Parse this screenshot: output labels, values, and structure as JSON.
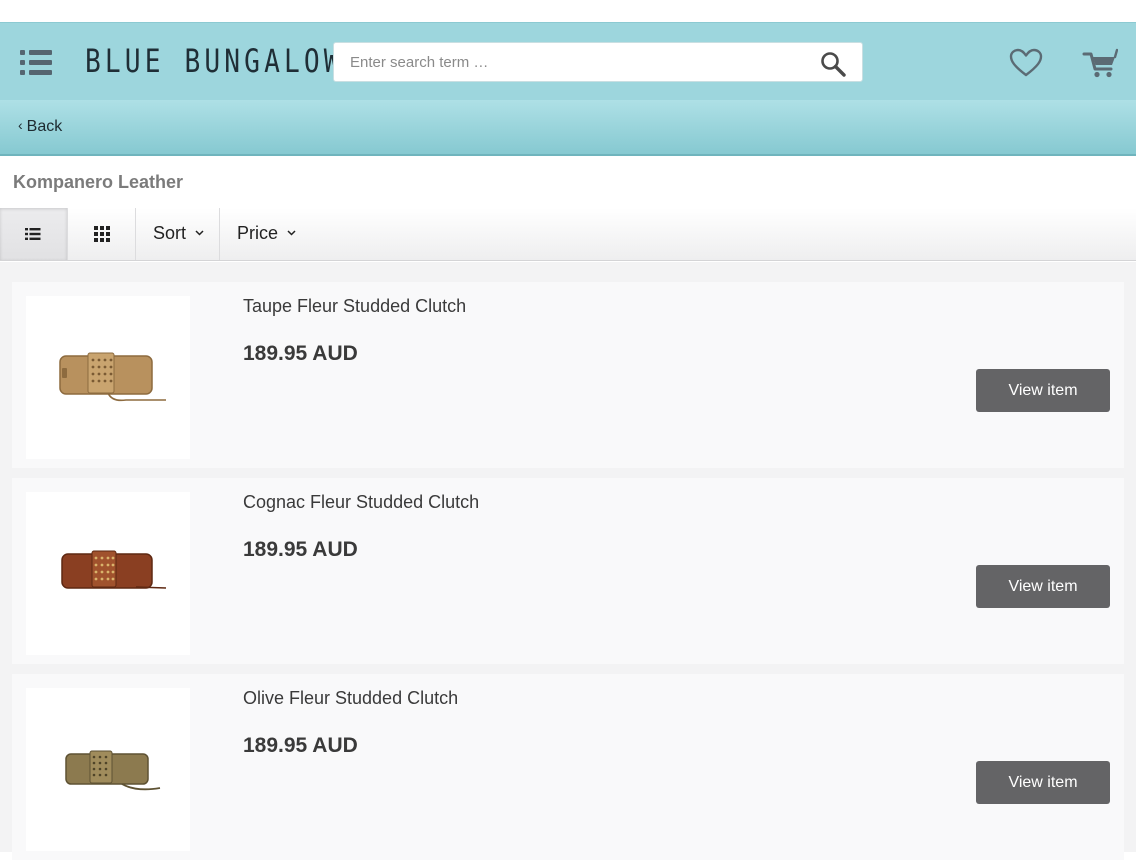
{
  "header": {
    "logo": "BLUE BUNGALOW",
    "search": {
      "placeholder": "Enter search term …",
      "value": ""
    },
    "icons": [
      "menu-icon",
      "search-icon",
      "heart-icon",
      "cart-icon"
    ]
  },
  "subbar": {
    "back_label": "Back"
  },
  "page": {
    "title": "Kompanero Leather"
  },
  "toolbar": {
    "views": [
      "list-view-icon",
      "grid-view-icon"
    ],
    "sort_label": "Sort",
    "price_label": "Price"
  },
  "products": [
    {
      "name": "Taupe Fleur Studded Clutch",
      "price": "189.95 AUD",
      "button": "View item",
      "color": "#b8915e"
    },
    {
      "name": "Cognac Fleur Studded Clutch",
      "price": "189.95 AUD",
      "button": "View item",
      "color": "#8a3f22"
    },
    {
      "name": "Olive Fleur Studded Clutch",
      "price": "189.95 AUD",
      "button": "View item",
      "color": "#8c7a4f"
    }
  ],
  "colors": {
    "header_bg": "#9dd6dd",
    "button_bg": "#646466"
  }
}
